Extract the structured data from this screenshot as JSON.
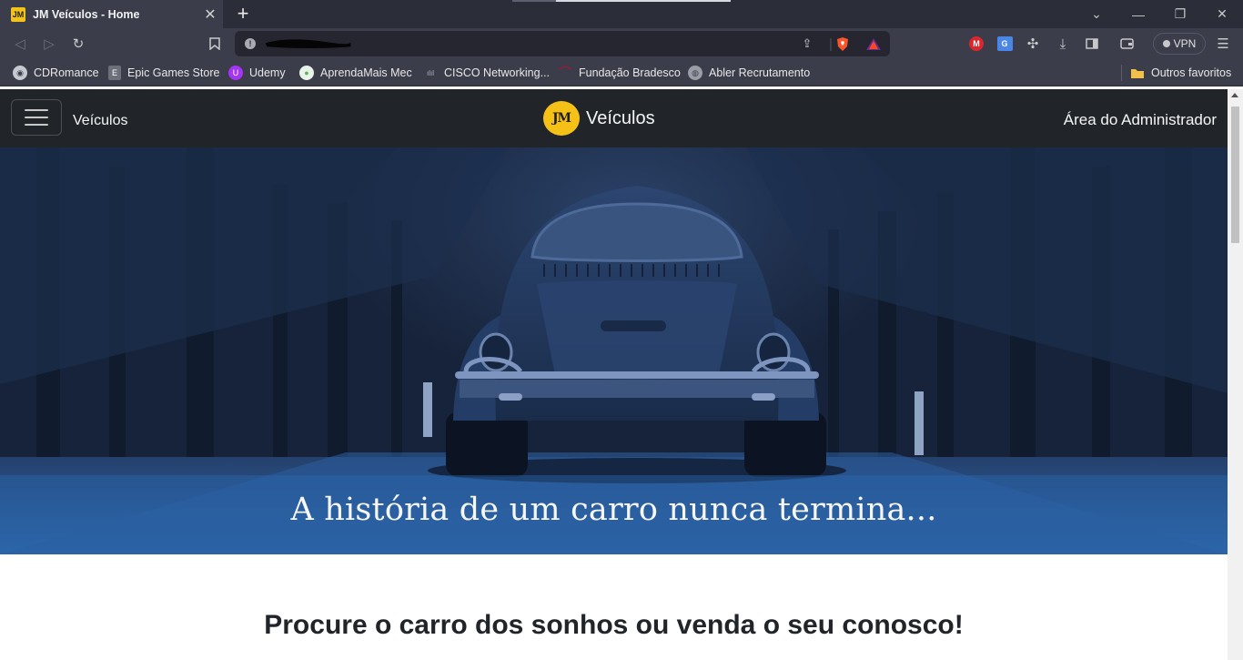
{
  "browser": {
    "tab": {
      "title": "JM Veículos - Home",
      "favicon": "JM"
    },
    "new_tab_icon": "plus-icon",
    "vpn_label": "VPN",
    "bookmarks": [
      {
        "label": "CDRomance",
        "icon": "cd-icon",
        "color": "#c7c9d1"
      },
      {
        "label": "Epic Games Store",
        "icon": "epic-icon",
        "color": "#6d6f7a"
      },
      {
        "label": "Udemy",
        "icon": "udemy-icon",
        "color": "#a435f0"
      },
      {
        "label": "AprendaMais Mec",
        "icon": "aprenda-icon",
        "color": "#5ab55d"
      },
      {
        "label": "CISCO Networking...",
        "icon": "cisco-icon",
        "color": "#8a8c96"
      },
      {
        "label": "Fundação Bradesco",
        "icon": "bradesco-icon",
        "color": "#cc092f"
      },
      {
        "label": "Abler Recrutamento",
        "icon": "globe-icon",
        "color": "#9a9ca6"
      }
    ],
    "other_bookmarks": "Outros favoritos"
  },
  "site": {
    "nav": {
      "left_label": "Veículos",
      "brand_logo": "JM",
      "brand_text": "Veículos",
      "admin_link": "Área do Administrador"
    },
    "hero": {
      "caption": "A história de um carro nunca termina..."
    },
    "subtitle": "Procure o carro dos sonhos ou venda o seu conosco!"
  },
  "colors": {
    "navbar": "#212529",
    "logo": "#f6c117",
    "hero_tint": "#275da0",
    "browser_chrome": "#3b3d4a"
  }
}
